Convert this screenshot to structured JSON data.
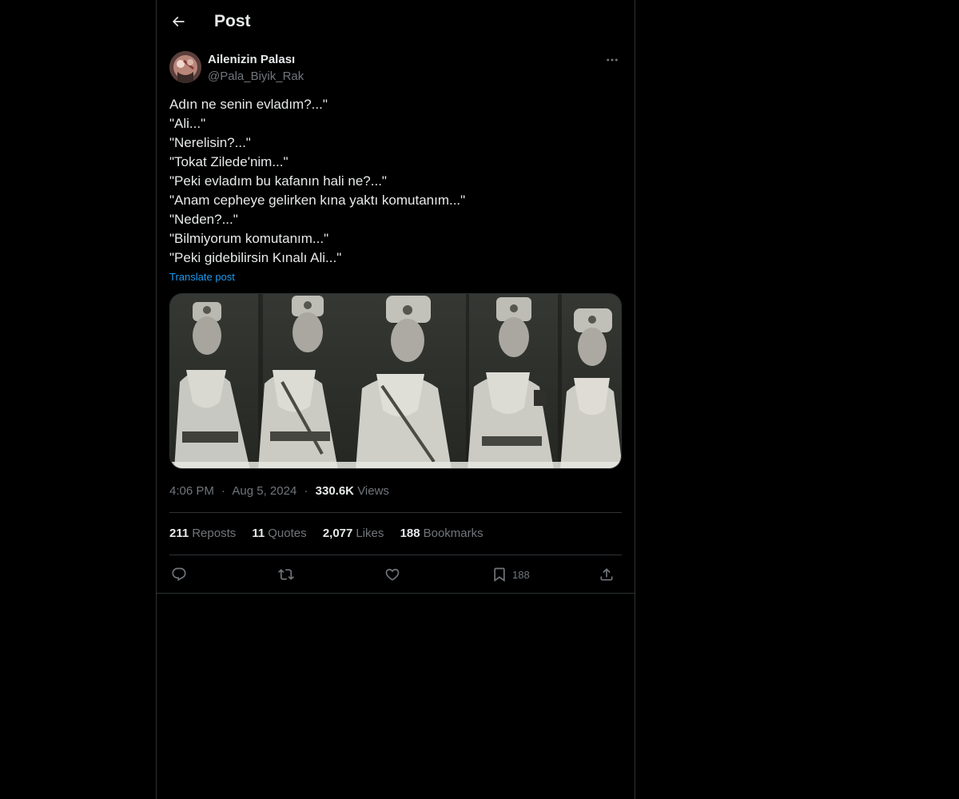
{
  "header": {
    "title": "Post"
  },
  "author": {
    "name": "Ailenizin Palası",
    "handle": "@Pala_Biyik_Rak"
  },
  "post": {
    "lines": [
      "Adın ne senin evladım?...\"",
      "\"Ali...\"",
      "\"Nerelisin?...\"",
      "\"Tokat Zilede'nim...\"",
      "\"Peki evladım bu kafanın hali ne?...\"",
      "\"Anam cepheye gelirken kına yaktı komutanım...\"",
      "\"Neden?...\"",
      "\"Bilmiyorum komutanım...\"",
      "\"Peki gidebilirsin Kınalı Ali...\""
    ],
    "translate_label": "Translate post",
    "time": "4:06 PM",
    "date": "Aug 5, 2024",
    "views_count": "330.6K",
    "views_label": "Views",
    "meta_separator": "·"
  },
  "stats": {
    "reposts": {
      "count": "211",
      "label": "Reposts"
    },
    "quotes": {
      "count": "11",
      "label": "Quotes"
    },
    "likes": {
      "count": "2,077",
      "label": "Likes"
    },
    "bookmarks": {
      "count": "188",
      "label": "Bookmarks"
    }
  },
  "actions": {
    "bookmark_count": "188",
    "icons": [
      "reply-icon",
      "repost-icon",
      "like-icon",
      "bookmark-icon",
      "share-icon"
    ]
  },
  "colors": {
    "background": "#000000",
    "text_primary": "#e7e9ea",
    "text_secondary": "#71767b",
    "link": "#1d9bf0",
    "border": "#2f3336"
  }
}
